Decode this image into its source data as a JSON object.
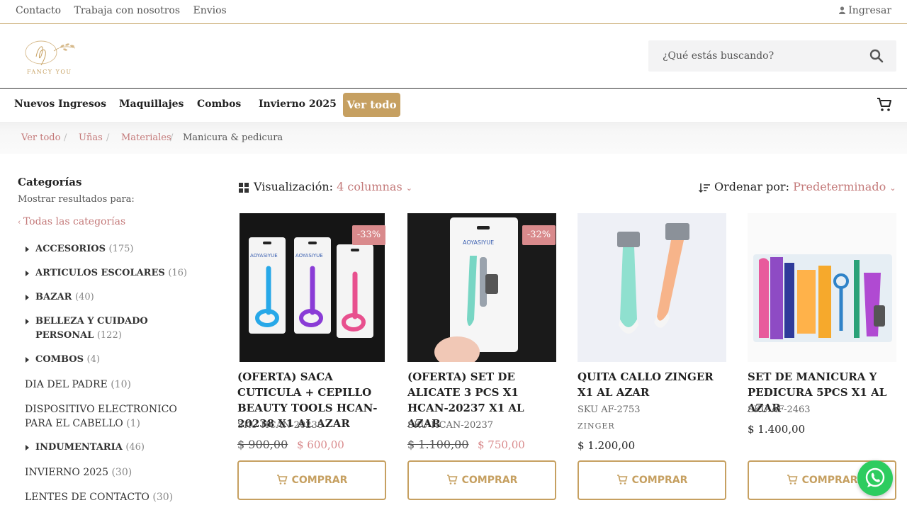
{
  "topbar": {
    "links": [
      "Contacto",
      "Trabaja con nosotros",
      "Envios"
    ],
    "login": "Ingresar"
  },
  "header": {
    "logo_text": "FANCY YOU",
    "search_placeholder": "¿Qué estás buscando?"
  },
  "nav": {
    "items": [
      "Nuevos Ingresos",
      "Maquillajes",
      "Combos",
      "Invierno 2025"
    ],
    "highlight": "Ver todo"
  },
  "breadcrumb": [
    "Ver todo",
    "Uñas",
    "Materiales",
    "Manicura & pedicura"
  ],
  "sidebar": {
    "title": "Categorías",
    "subtitle": "Mostrar resultados para:",
    "all": "Todas las categorías",
    "categories": [
      {
        "name": "ACCESORIOS",
        "count": "(175)"
      },
      {
        "name": "ARTICULOS ESCOLARES",
        "count": "(16)"
      },
      {
        "name": "BAZAR",
        "count": "(40)"
      },
      {
        "name": "BELLEZA Y CUIDADO PERSONAL",
        "count": "(122)"
      },
      {
        "name": "COMBOS",
        "count": "(4)"
      },
      {
        "name": "DIA DEL PADRE",
        "count": "(10)"
      },
      {
        "name": "DISPOSITIVO ELECTRONICO PARA EL CABELLO",
        "count": "(1)"
      },
      {
        "name": "INDUMENTARIA",
        "count": "(46)"
      },
      {
        "name": "INVIERNO 2025",
        "count": "(30)"
      },
      {
        "name": "LENTES DE CONTACTO",
        "count": "(30)"
      }
    ]
  },
  "toolbar": {
    "view_label": "Visualización:",
    "view_value": "4 columnas",
    "sort_label": "Ordenar por:",
    "sort_value": "Predeterminado"
  },
  "products": [
    {
      "name": "(OFERTA) SACA CUTICULA + CEPILLO BEAUTY TOOLS HCAN-20238 X1 AL AZAR",
      "sku": "SKU HCAN-20238",
      "badge": "-33%",
      "old_price": "$ 900,00",
      "price": "$ 600,00",
      "cta": "COMPRAR"
    },
    {
      "name": "(OFERTA) SET DE ALICATE 3 PCS X1 HCAN-20237 X1 AL AZAR",
      "sku": "SKU HCAN-20237",
      "badge": "-32%",
      "old_price": "$ 1.100,00",
      "price": "$ 750,00",
      "cta": "COMPRAR"
    },
    {
      "name": "QUITA CALLO ZINGER X1 AL AZAR",
      "sku": "SKU AF-2753",
      "brand": "ZINGER",
      "price": "$ 1.200,00",
      "cta": "COMPRAR"
    },
    {
      "name": "SET DE MANICURA Y PEDICURA 5PCS X1 AL AZAR",
      "sku": "SKU AF-2463",
      "price": "$ 1.400,00",
      "cta": "COMPRAR"
    }
  ],
  "images": {
    "p1": "AOYASIYUE",
    "p2": "AOYASIYUE"
  },
  "colors": {
    "accent": "#c6a061",
    "link": "#c47a7a",
    "badge": "#d98a8c",
    "whatsapp": "#2dcc5f"
  }
}
